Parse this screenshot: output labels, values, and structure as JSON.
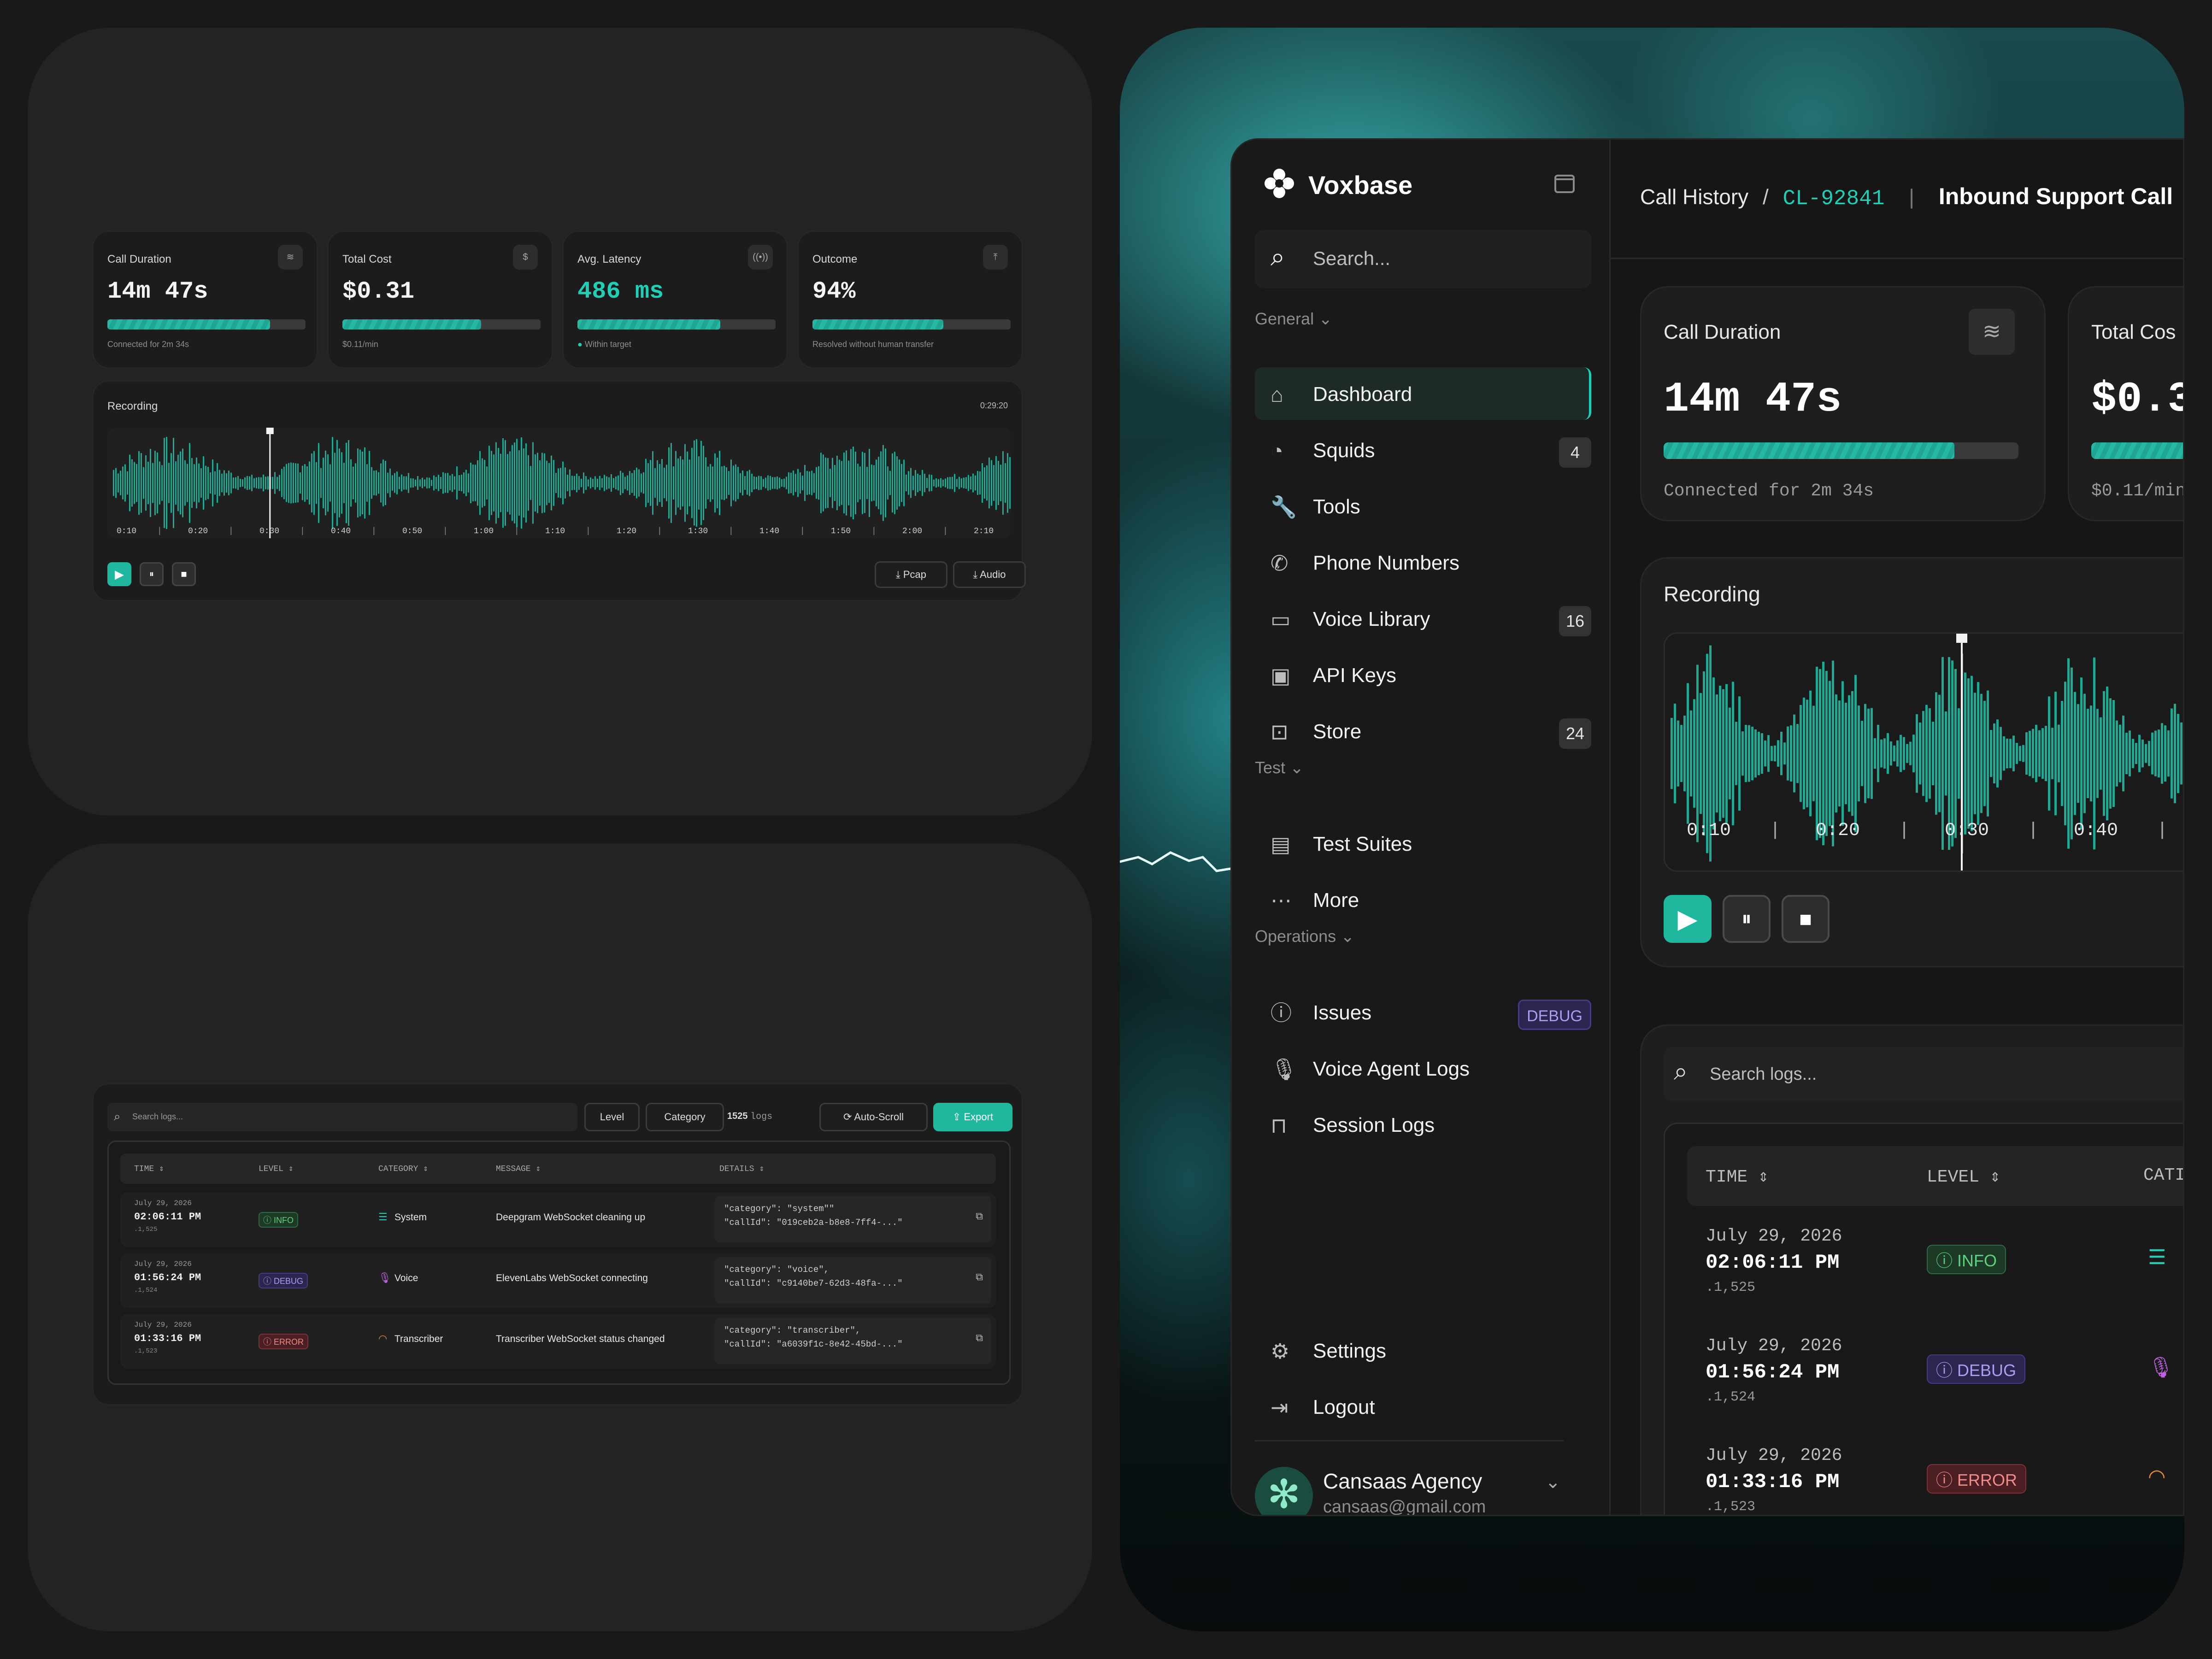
{
  "cards": [
    {
      "label": "Call Duration",
      "value": "14m 47s",
      "sub": "Connected for 2m 34s",
      "progress": 0.82,
      "icon": "waves-icon",
      "accent": false
    },
    {
      "label": "Total Cost",
      "value": "$0.31",
      "sub": "$0.11/min",
      "progress": 0.7,
      "icon": "dollar-icon",
      "accent": false
    },
    {
      "label": "Avg. Latency",
      "value": "486 ms",
      "sub": "Within target",
      "progress": 0.72,
      "icon": "signal-icon",
      "accent": true
    },
    {
      "label": "Outcome",
      "value": "94%",
      "sub": "Resolved without human transfer",
      "progress": 0.66,
      "icon": "arrow-up-icon",
      "accent": false
    }
  ],
  "recording": {
    "title": "Recording",
    "total": "0:29:20",
    "ticks": [
      "0:10",
      "0:20",
      "0:30",
      "0:40",
      "0:50",
      "1:00",
      "1:10",
      "1:20",
      "1:30",
      "1:40",
      "1:50",
      "2:00",
      "2:10"
    ],
    "playhead": 0.18,
    "pcap": "Pcap",
    "audio": "Audio"
  },
  "logs": {
    "search_placeholder": "Search logs...",
    "level": "Level",
    "category": "Category",
    "count": "1525",
    "count_unit": "logs",
    "autoscroll": "Auto-Scroll",
    "export": "Export",
    "headers": [
      "TIME",
      "LEVEL",
      "CATEGORY",
      "MESSAGE",
      "DETAILS"
    ],
    "rows": [
      {
        "date": "July 29, 2026",
        "time": "02:06:11 PM",
        "seq": ".1,525",
        "level": "INFO",
        "category": "System",
        "message": "Deepgram WebSocket cleaning up",
        "d1": "\"category\": \"system\"\"",
        "d2": "\"callId\": \"019ceb2a-b8e8-7ff4-...\""
      },
      {
        "date": "July 29, 2026",
        "time": "01:56:24 PM",
        "seq": ".1,524",
        "level": "DEBUG",
        "category": "Voice",
        "message": "ElevenLabs WebSocket connecting",
        "d1": "\"category\": \"voice\",",
        "d2": "\"callId\": \"c9140be7-62d3-48fa-...\""
      },
      {
        "date": "July 29, 2026",
        "time": "01:33:16 PM",
        "seq": ".1,523",
        "level": "ERROR",
        "category": "Transcriber",
        "message": "Transcriber WebSocket status changed",
        "d1": "\"category\": \"transcriber\",",
        "d2": "\"callId\": \"a6039f1c-8e42-45bd-...\""
      }
    ]
  },
  "app": {
    "brand": "Voxbase",
    "search": "Search...",
    "sections": {
      "general": "General",
      "test": "Test",
      "operations": "Operations"
    },
    "nav": [
      {
        "label": "Dashboard",
        "count": "",
        "icon": "home-icon"
      },
      {
        "label": "Squids",
        "count": "4",
        "icon": "gauge-icon"
      },
      {
        "label": "Tools",
        "count": "",
        "icon": "wrench-icon"
      },
      {
        "label": "Phone Numbers",
        "count": "",
        "icon": "phone-icon"
      },
      {
        "label": "Voice Library",
        "count": "16",
        "icon": "monitor-icon"
      },
      {
        "label": "API Keys",
        "count": "",
        "icon": "terminal-icon"
      },
      {
        "label": "Store",
        "count": "24",
        "icon": "store-icon"
      },
      {
        "label": "Test Suites",
        "count": "",
        "icon": "clipboard-search-icon"
      },
      {
        "label": "More",
        "count": "",
        "icon": "dots-icon"
      },
      {
        "label": "Issues",
        "count": "DEBUG",
        "icon": "info-icon"
      },
      {
        "label": "Voice Agent Logs",
        "count": "",
        "icon": "mic-icon"
      },
      {
        "label": "Session Logs",
        "count": "",
        "icon": "book-icon"
      },
      {
        "label": "Settings",
        "count": "",
        "icon": "gear-icon"
      },
      {
        "label": "Logout",
        "count": "",
        "icon": "logout-icon"
      }
    ],
    "user": {
      "name": "Cansaas Agency",
      "email": "cansaas@gmail.com"
    },
    "breadcrumb": {
      "root": "Call History",
      "sep": "/",
      "id": "CL-92841",
      "title": "Inbound Support Call"
    },
    "total_cost_label": "Total Cos",
    "total_cost_value": "$0.3",
    "total_cost_sub": "$0.11/min",
    "big_ticks": [
      "0:10",
      "0:20",
      "0:30",
      "0:40"
    ],
    "cat_short": "CATI"
  },
  "colors": {
    "accent": "#1fcfb6",
    "info": "#5fd07f",
    "debug": "#a99ff0",
    "error": "#ef8b8b"
  }
}
